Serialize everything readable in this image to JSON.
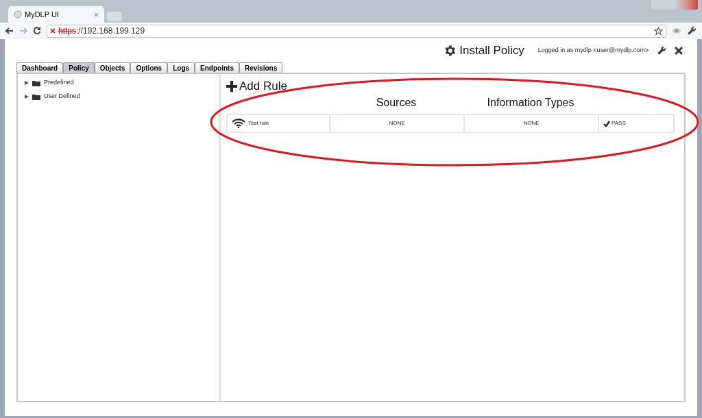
{
  "browser": {
    "tab_title": "MyDLP UI",
    "url_struck": "https",
    "url_rest": "://192.168.199.129"
  },
  "header": {
    "install_label": "Install Policy",
    "login_text": "Logged in as mydlp <user@mydlp.com>"
  },
  "tabs": [
    {
      "label": "Dashboard",
      "selected": false
    },
    {
      "label": "Policy",
      "selected": true
    },
    {
      "label": "Objects",
      "selected": false
    },
    {
      "label": "Options",
      "selected": false
    },
    {
      "label": "Logs",
      "selected": false
    },
    {
      "label": "Endpoints",
      "selected": false
    },
    {
      "label": "Revisions",
      "selected": false
    }
  ],
  "tree": [
    {
      "label": "Predefined",
      "expanded": false
    },
    {
      "label": "User Defined",
      "expanded": false
    }
  ],
  "rules": {
    "add_label": "Add Rule",
    "columns": [
      "Sources",
      "Information Types"
    ],
    "rows": [
      {
        "name": "Test rule",
        "sources": "NONE",
        "information_types": "NONE",
        "action": "PASS"
      }
    ]
  },
  "annotation": {
    "kind": "ellipse"
  }
}
